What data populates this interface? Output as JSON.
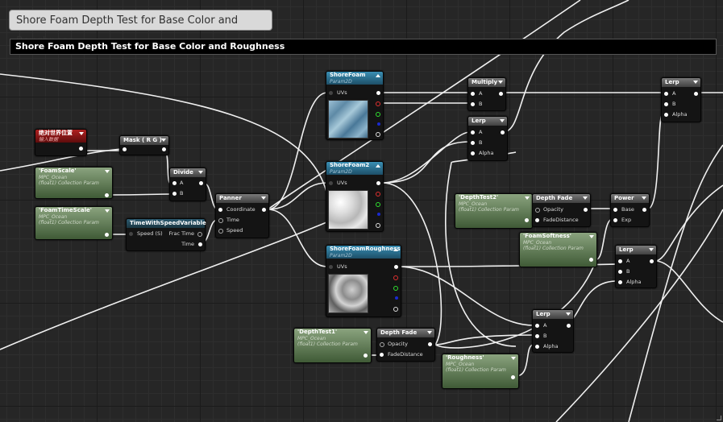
{
  "window": {
    "tab_title": "Shore Foam Depth Test for Base Color and Roughness"
  },
  "comment": {
    "title": "Shore Foam Depth Test for Base Color and Roughness"
  },
  "nodes": {
    "world_pos": {
      "title": "绝对世界位置",
      "subtitle": "输入数据"
    },
    "mask": {
      "title": "Mask ( R G )"
    },
    "foam_scale": {
      "title": "'FoamScale'",
      "sub1": "MPC_Ocean",
      "sub2": "(float1) Collection Param"
    },
    "foam_time_scale": {
      "title": "'FoamTimeScale'",
      "sub1": "MPC_Ocean",
      "sub2": "(float1) Collection Param"
    },
    "divide": {
      "title": "Divide",
      "pin_a": "A",
      "pin_b": "B"
    },
    "time_speed": {
      "title": "TimeWithSpeedVariable",
      "in_speed": "Speed (S)",
      "out_frac": "Frac Time",
      "out_time": "Time"
    },
    "panner": {
      "title": "Panner",
      "in_coord": "Coordinate",
      "in_time": "Time",
      "in_speed": "Speed"
    },
    "shore_foam": {
      "title": "ShoreFoam",
      "subtitle": "Param2D",
      "in_uvs": "UVs"
    },
    "shore_foam2": {
      "title": "ShoreFoam2",
      "subtitle": "Param2D",
      "in_uvs": "UVs"
    },
    "shore_foam_rough": {
      "title": "ShoreFoamRoughness",
      "subtitle": "Param2D",
      "in_uvs": "UVs"
    },
    "multiply": {
      "title": "Multiply",
      "pin_a": "A",
      "pin_b": "B"
    },
    "lerp1": {
      "title": "Lerp",
      "pin_a": "A",
      "pin_b": "B",
      "pin_alpha": "Alpha"
    },
    "lerp_top": {
      "title": "Lerp",
      "pin_a": "A",
      "pin_b": "B",
      "pin_alpha": "Alpha"
    },
    "depth_test2": {
      "title": "'DepthTest2'",
      "sub1": "MPC_Ocean",
      "sub2": "(float1) Collection Param"
    },
    "depth_fade1": {
      "title": "Depth Fade",
      "pin_opacity": "Opacity",
      "pin_fade": "FadeDistance"
    },
    "power": {
      "title": "Power",
      "pin_base": "Base",
      "pin_exp": "Exp"
    },
    "foam_softness": {
      "title": "'FoamSoftness'",
      "sub1": "MPC_Ocean",
      "sub2": "(float1) Collection Param"
    },
    "lerp_mid": {
      "title": "Lerp",
      "pin_a": "A",
      "pin_b": "B",
      "pin_alpha": "Alpha"
    },
    "lerp_low": {
      "title": "Lerp",
      "pin_a": "A",
      "pin_b": "B",
      "pin_alpha": "Alpha"
    },
    "depth_test1": {
      "title": "'DepthTest1'",
      "sub1": "MPC_Ocean",
      "sub2": "(float1) Collection Param"
    },
    "depth_fade2": {
      "title": "Depth Fade",
      "pin_opacity": "Opacity",
      "pin_fade": "FadeDistance"
    },
    "roughness": {
      "title": "'Roughness'",
      "sub1": "MPC_Ocean",
      "sub2": "(float1) Collection Param"
    }
  },
  "icons": [
    "collapse-arrow-icon",
    "exec-pin-icon",
    "resize-corner-icon"
  ],
  "colors": {
    "texture_header": "#2f7ea3",
    "param_header": "#587a4c",
    "red_header": "#9a1a1a",
    "wire": "#f0f0f0"
  }
}
